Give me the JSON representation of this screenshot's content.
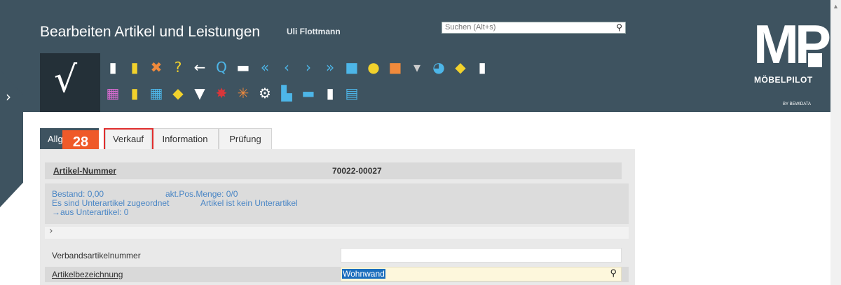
{
  "header": {
    "title": "Bearbeiten Artikel und Leistungen",
    "user": "Uli Flottmann",
    "search_placeholder": "Suchen (Alt+s)",
    "checkmark": "√",
    "side_toggle": "›"
  },
  "logo": {
    "mark": "MP",
    "brand": "MÖBELPILOT",
    "sub": "BY BEWIDATA"
  },
  "toolbar_row1": [
    {
      "icon": "new-document-icon",
      "glyph": "▮",
      "color": "#ffffff"
    },
    {
      "icon": "copy-document-icon",
      "glyph": "▮",
      "color": "#f2d22c"
    },
    {
      "icon": "delete-icon",
      "glyph": "✖",
      "color": "#f08a3c"
    },
    {
      "icon": "help-icon",
      "glyph": "?",
      "color": "#f2d22c"
    },
    {
      "icon": "back-icon",
      "glyph": "←",
      "color": "#ffffff"
    },
    {
      "icon": "search-icon",
      "glyph": "Q",
      "color": "#4db6e8"
    },
    {
      "icon": "print-icon",
      "glyph": "▬",
      "color": "#ffffff"
    },
    {
      "icon": "first-record-icon",
      "glyph": "«",
      "color": "#4db6e8"
    },
    {
      "icon": "previous-record-icon",
      "glyph": "‹",
      "color": "#4db6e8"
    },
    {
      "icon": "next-record-icon",
      "glyph": "›",
      "color": "#4db6e8"
    },
    {
      "icon": "last-record-icon",
      "glyph": "»",
      "color": "#4db6e8"
    },
    {
      "icon": "boxes-icon",
      "glyph": "■",
      "color": "#4db6e8"
    },
    {
      "icon": "coins-icon",
      "glyph": "●",
      "color": "#f2d22c"
    },
    {
      "icon": "package-icon",
      "glyph": "■",
      "color": "#f08a3c"
    },
    {
      "icon": "screw-icon",
      "glyph": "▾",
      "color": "#cccccc"
    },
    {
      "icon": "chart-icon",
      "glyph": "◕",
      "color": "#4db6e8"
    },
    {
      "icon": "tag-icon",
      "glyph": "◆",
      "color": "#f2d22c"
    },
    {
      "icon": "documents-icon",
      "glyph": "▮",
      "color": "#ffffff"
    }
  ],
  "toolbar_row2": [
    {
      "icon": "calendar-01-icon",
      "glyph": "▦",
      "color": "#d66bd0"
    },
    {
      "icon": "edit-icon",
      "glyph": "▮",
      "color": "#f2d22c"
    },
    {
      "icon": "calendar-30-icon",
      "glyph": "▦",
      "color": "#4db6e8"
    },
    {
      "icon": "sticker-icon",
      "glyph": "◆",
      "color": "#f2d22c"
    },
    {
      "icon": "vbs-icon",
      "glyph": "▼",
      "color": "#ffffff"
    },
    {
      "icon": "flag-icon",
      "glyph": "✸",
      "color": "#d8363a"
    },
    {
      "icon": "network-icon",
      "glyph": "✳",
      "color": "#f08a3c"
    },
    {
      "icon": "gear-icon",
      "glyph": "⚙",
      "color": "#ffffff"
    },
    {
      "icon": "factory-icon",
      "glyph": "▙",
      "color": "#4db6e8"
    },
    {
      "icon": "truck-icon",
      "glyph": "▬",
      "color": "#4db6e8"
    },
    {
      "icon": "doc-tag-icon",
      "glyph": "▮",
      "color": "#ffffff"
    },
    {
      "icon": "contact-card-icon",
      "glyph": "▤",
      "color": "#4db6e8"
    }
  ],
  "tabs": [
    {
      "label": "Allg"
    },
    {
      "label": "Verkauf"
    },
    {
      "label": "Information"
    },
    {
      "label": "Prüfung"
    }
  ],
  "step_badge": "28",
  "article": {
    "label": "Artikel-Nummer",
    "value": "70022-00027"
  },
  "info": {
    "bestand": "Bestand: 0,00",
    "akt_menge": "akt.Pos.Menge: 0/0",
    "unterartikel_zugeordnet": "Es sind Unterartikel zugeordnet",
    "kein_unterartikel": "Artikel ist kein Unterartikel",
    "aus_unterartikel": "→aus Unterartikel: 0"
  },
  "expand_chevron": "›",
  "fields": {
    "verband_label": "Verbandsartikelnummer",
    "verband_value": "",
    "bezeichnung_label": "Artikelbezeichnung",
    "bezeichnung_value": "Wohnwand"
  },
  "search_glyph": "🔍"
}
